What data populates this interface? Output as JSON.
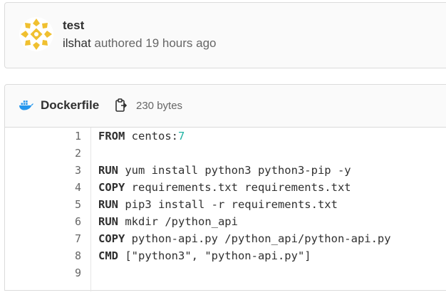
{
  "commit": {
    "title": "test",
    "author": "ilshat",
    "meta_text": " authored 19 hours ago",
    "avatar_icon": "identicon-avatar-icon"
  },
  "file": {
    "name": "Dockerfile",
    "size": "230 bytes",
    "file_icon": "docker-icon",
    "copy_icon": "copy-clipboard-icon"
  },
  "code": {
    "lines": [
      {
        "num": "1",
        "tokens": [
          {
            "t": "FROM",
            "k": "kw"
          },
          {
            "t": " centos:",
            "k": ""
          },
          {
            "t": "7",
            "k": "num"
          }
        ]
      },
      {
        "num": "2",
        "tokens": []
      },
      {
        "num": "3",
        "tokens": [
          {
            "t": "RUN",
            "k": "kw"
          },
          {
            "t": " yum install python3 python3-pip -y",
            "k": ""
          }
        ]
      },
      {
        "num": "4",
        "tokens": [
          {
            "t": "COPY",
            "k": "kw"
          },
          {
            "t": " requirements.txt requirements.txt",
            "k": ""
          }
        ]
      },
      {
        "num": "5",
        "tokens": [
          {
            "t": "RUN",
            "k": "kw"
          },
          {
            "t": " pip3 install -r requirements.txt",
            "k": ""
          }
        ]
      },
      {
        "num": "6",
        "tokens": [
          {
            "t": "RUN",
            "k": "kw"
          },
          {
            "t": " mkdir /python_api",
            "k": ""
          }
        ]
      },
      {
        "num": "7",
        "tokens": [
          {
            "t": "COPY",
            "k": "kw"
          },
          {
            "t": " python-api.py /python_api/python-api.py",
            "k": ""
          }
        ]
      },
      {
        "num": "8",
        "tokens": [
          {
            "t": "CMD",
            "k": "kw"
          },
          {
            "t": " [\"python3\", \"python-api.py\"]",
            "k": ""
          }
        ]
      },
      {
        "num": "9",
        "tokens": []
      }
    ]
  },
  "colors": {
    "avatar": "#f0c030",
    "docker": "#2496ed",
    "number_literal": "#20b3a3"
  }
}
